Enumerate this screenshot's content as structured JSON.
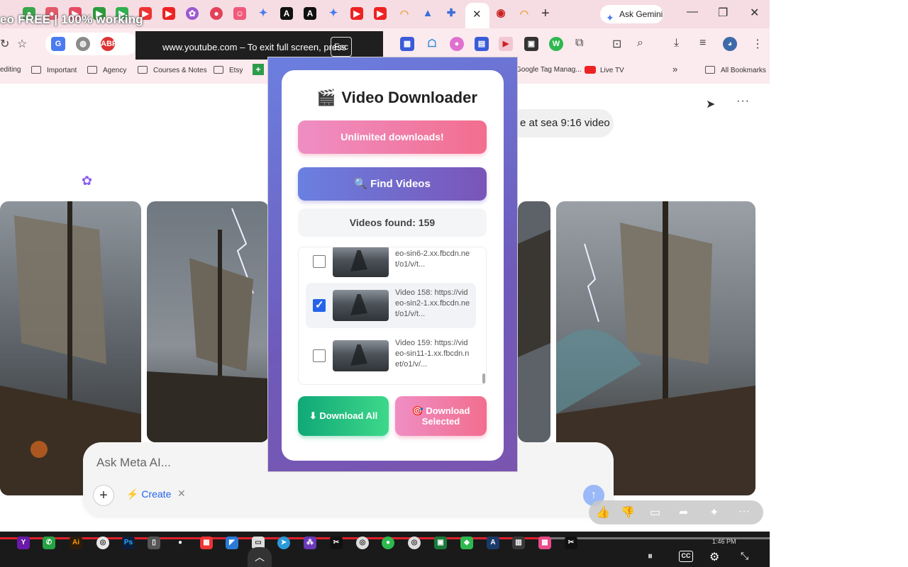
{
  "video_title": "eo FREE | 100% working",
  "fullscreen_toast": {
    "message": "www.youtube.com – To exit full screen, press",
    "key": "Esc"
  },
  "tabs": {
    "ask_gemini": "Ask Gemini",
    "new_tab": "+",
    "close": "✕"
  },
  "bookmarks": [
    {
      "label": "editing"
    },
    {
      "label": "Important"
    },
    {
      "label": "Agency"
    },
    {
      "label": "Courses & Notes"
    },
    {
      "label": "Etsy"
    },
    {
      "label": "Google Tag Manag..."
    },
    {
      "label": "Live TV"
    },
    {
      "label": "All Bookmarks"
    }
  ],
  "page": {
    "prompt_text": "e at sea 9:16 video",
    "ask_placeholder": "Ask Meta AI...",
    "create_label": "Create"
  },
  "popup": {
    "title": "Video Downloader",
    "unlimited_label": "Unlimited downloads!",
    "find_label": "Find Videos",
    "found_label": "Videos found:",
    "found_count": "159",
    "videos": [
      {
        "text": "eo-sin6-2.xx.fbcdn.ne t/o1/v/t...",
        "checked": false
      },
      {
        "text": "Video 158: https://vid eo-sin2-1.xx.fbcdn.ne t/o1/v/t...",
        "checked": true
      },
      {
        "text": "Video 159: https://vid eo-sin11-1.xx.fbcdn.n et/o1/v/...",
        "checked": false
      }
    ],
    "download_all_label": "Download All",
    "download_selected_label": "Download Selected"
  },
  "taskbar": {
    "time": "1:46 PM",
    "cc": "CC"
  },
  "colors": {
    "accent_pink": "#f26e8e",
    "accent_purple": "#7a55b8",
    "accent_green": "#10a878",
    "progress_red": "#e0202b"
  }
}
